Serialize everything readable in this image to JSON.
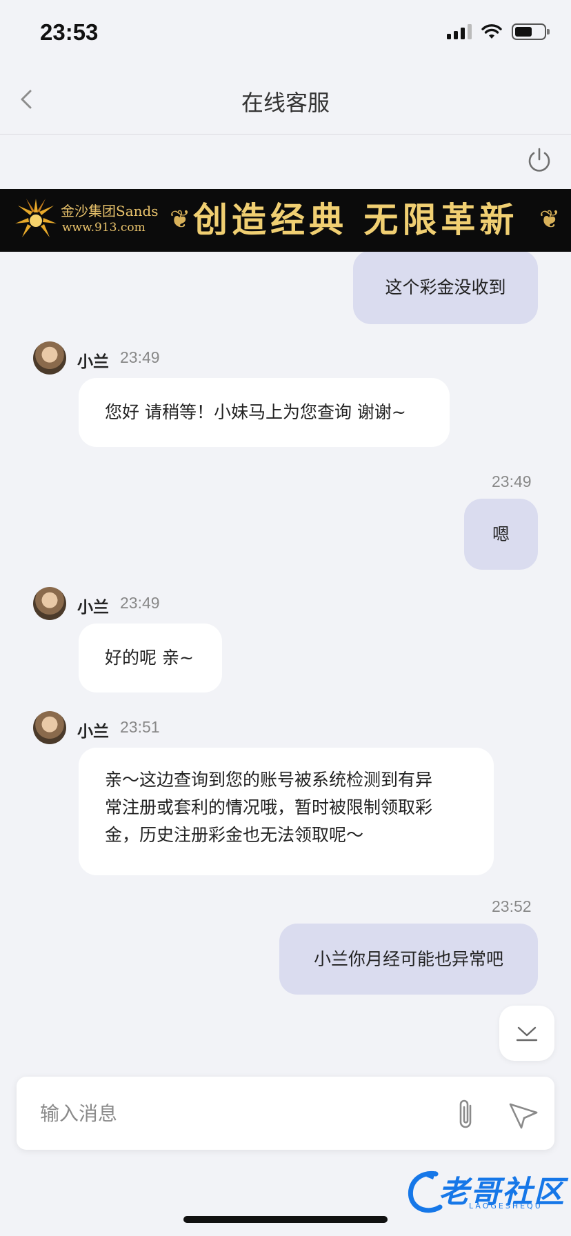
{
  "status_bar": {
    "time": "23:53"
  },
  "nav": {
    "title": "在线客服"
  },
  "banner": {
    "brand": "金沙集团Sands",
    "url": "www.913.com",
    "slogan": "创造经典 无限革新"
  },
  "messages": [
    {
      "direction": "out",
      "time": "",
      "text": "这个彩金没收到"
    },
    {
      "direction": "in",
      "sender": "小兰",
      "time": "23:49",
      "text": "您好 请稍等！小妹马上为您查询 谢谢~"
    },
    {
      "direction": "out",
      "time": "23:49",
      "text": "嗯"
    },
    {
      "direction": "in",
      "sender": "小兰",
      "time": "23:49",
      "text": "好的呢 亲~"
    },
    {
      "direction": "in",
      "sender": "小兰",
      "time": "23:51",
      "lines": [
        "亲～这边查询到您的账号被系统检测到有异",
        "常注册或套利的情况哦，暂时被限制领取彩",
        "金，历史注册彩金也无法领取呢～"
      ]
    },
    {
      "direction": "out",
      "time": "23:52",
      "text": "小兰你月经可能也异常吧"
    }
  ],
  "input": {
    "placeholder": "输入消息"
  },
  "watermark": {
    "text": "老哥社区",
    "sub": "LAOGESHEQU"
  },
  "icons": {
    "back": "chevron-left-icon",
    "power": "power-icon",
    "scroll": "scroll-down-icon",
    "attach": "paperclip-icon",
    "send": "send-icon"
  },
  "colors": {
    "background": "#f2f3f7",
    "outgoing_bubble": "#dadcef",
    "incoming_bubble": "#ffffff",
    "banner_gold": "#f0cf72",
    "watermark_blue": "#1677e8"
  }
}
